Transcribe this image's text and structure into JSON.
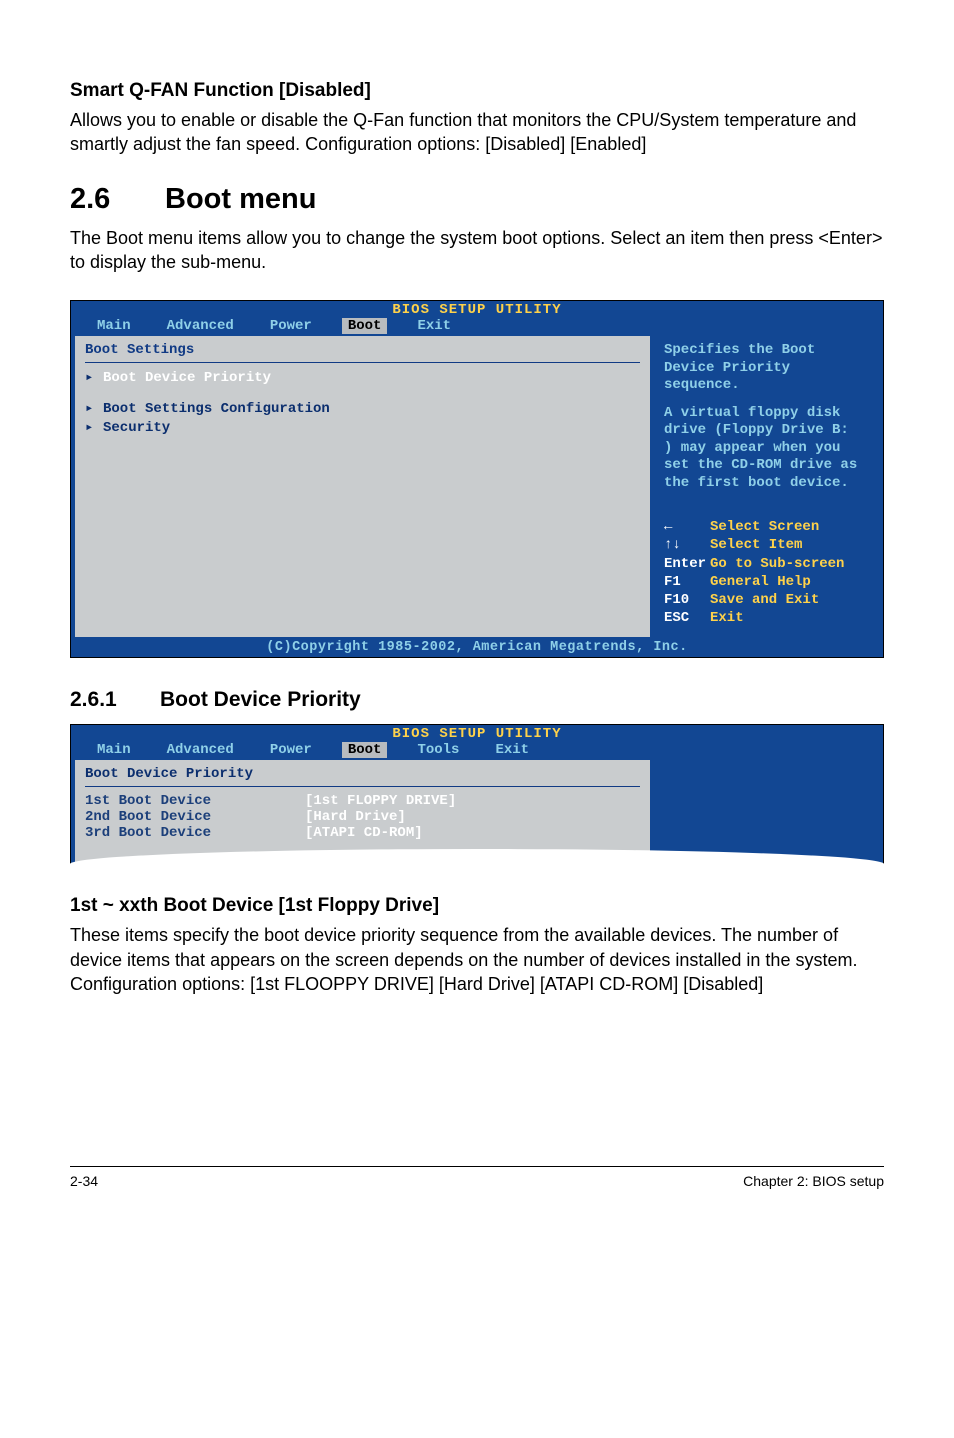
{
  "section1": {
    "heading": "Smart Q-FAN Function [Disabled]",
    "body": "Allows you to enable or disable the Q-Fan function that monitors the CPU/System temperature and smartly adjust the fan speed. Configuration options: [Disabled] [Enabled]"
  },
  "section_main": {
    "num": "2.6",
    "title": "Boot menu",
    "body": "The Boot menu items allow you to change the system boot options. Select an item then press <Enter> to display the sub-menu."
  },
  "bios1": {
    "title": "BIOS SETUP UTILITY",
    "tabs": {
      "main": "Main",
      "advanced": "Advanced",
      "power": "Power",
      "boot": "Boot",
      "exit": "Exit"
    },
    "pane_header": "Boot Settings",
    "items": [
      {
        "label": "Boot Device Priority",
        "selected": true
      },
      {
        "label": "Boot Settings Configuration",
        "selected": false
      },
      {
        "label": "Security",
        "selected": false
      }
    ],
    "help1": "Specifies the Boot Device Priority sequence.",
    "help2": "A virtual floppy disk drive (Floppy Drive B:\n) may appear when you set the CD-ROM drive as the first boot device.",
    "nav": [
      {
        "icon": "←",
        "text": "Select Screen"
      },
      {
        "icon": "↑↓",
        "text": "Select Item"
      },
      {
        "icon": "Enter",
        "text": "Go to Sub-screen"
      },
      {
        "icon": "F1",
        "text": "General Help"
      },
      {
        "icon": "F10",
        "text": "Save and Exit"
      },
      {
        "icon": "ESC",
        "text": "Exit"
      }
    ],
    "copyright": "(C)Copyright 1985-2002, American Megatrends, Inc."
  },
  "section_sub": {
    "num": "2.6.1",
    "title": "Boot Device Priority"
  },
  "bios2": {
    "title": "BIOS SETUP UTILITY",
    "tabs": {
      "main": "Main",
      "advanced": "Advanced",
      "power": "Power",
      "boot": "Boot",
      "tools": "Tools",
      "exit": "Exit"
    },
    "pane_header": "Boot Device Priority",
    "rows": [
      {
        "k": "1st Boot Device",
        "v": "[1st FLOPPY DRIVE]"
      },
      {
        "k": "2nd Boot Device",
        "v": "[Hard Drive]"
      },
      {
        "k": "3rd Boot Device",
        "v": "[ATAPI CD-ROM]"
      }
    ]
  },
  "section2": {
    "heading": "1st ~ xxth Boot Device [1st Floppy Drive]",
    "body": "These items specify the boot device priority sequence from the available devices. The number of device items that appears on the screen depends on the number of devices installed in the system. Configuration options: [1st FLOOPPY DRIVE] [Hard Drive] [ATAPI CD-ROM] [Disabled]"
  },
  "footer": {
    "left": "2-34",
    "right": "Chapter 2: BIOS setup"
  }
}
